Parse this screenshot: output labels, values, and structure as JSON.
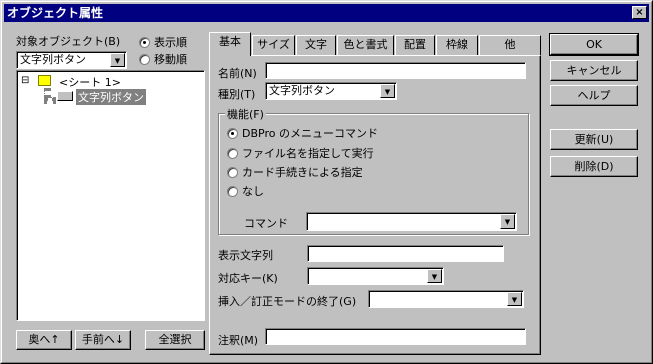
{
  "window": {
    "title": "オブジェクト属性",
    "close_glyph": "×"
  },
  "left": {
    "target_label": "対象オブジェクト(B)",
    "order_display": "表示順",
    "order_move": "移動順",
    "combo_value": "文字列ボタン",
    "tree": {
      "expander": "⊟",
      "root": "<シート 1>",
      "child": "文字列ボタン"
    },
    "buttons": {
      "back": "奥へ↑",
      "front": "手前へ↓",
      "select_all": "全選択"
    }
  },
  "tabs": [
    "基本",
    "サイズ",
    "文字",
    "色と書式",
    "配置",
    "枠線",
    "他"
  ],
  "form": {
    "name_label": "名前(N)",
    "name_value": "",
    "type_label": "種別(T)",
    "type_value": "文字列ボタン",
    "function_group": "機能(F)",
    "function_options": [
      "DBPro のメニューコマンド",
      "ファイル名を指定して実行",
      "カード手続きによる指定",
      "なし"
    ],
    "command_label": "コマンド",
    "command_value": "",
    "display_text_label": "表示文字列",
    "display_text_value": "",
    "key_label": "対応キー(K)",
    "key_value": "",
    "insert_end_label": "挿入／訂正モードの終了(G)",
    "insert_end_value": "",
    "note_label": "注釈(M)",
    "note_value": ""
  },
  "right_buttons": {
    "ok": "OK",
    "cancel": "キャンセル",
    "help": "ヘルプ",
    "update": "更新(U)",
    "delete": "削除(D)"
  },
  "icons": {
    "dropdown": "▼"
  }
}
